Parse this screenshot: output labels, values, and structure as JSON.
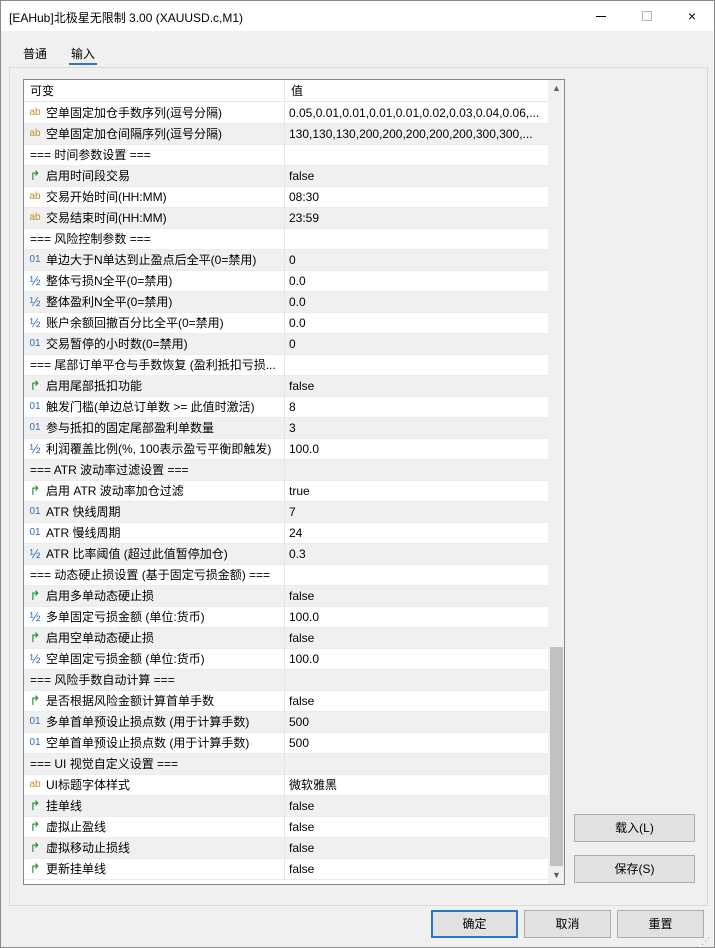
{
  "window": {
    "title": "[EAHub]北极星无限制 3.00 (XAUUSD.c,M1)",
    "controls": {
      "minimize": "minimize",
      "maximize": "maximize",
      "close": "×"
    }
  },
  "tabs": [
    {
      "label": "普通",
      "active": false
    },
    {
      "label": "输入",
      "active": true
    }
  ],
  "grid": {
    "columns": [
      "可变",
      "值"
    ],
    "rows": [
      {
        "type": "string",
        "name": "空单固定加仓手数序列(逗号分隔)",
        "value": "0.05,0.01,0.01,0.01,0.01,0.02,0.03,0.04,0.06,..."
      },
      {
        "type": "string",
        "name": "空单固定加仓间隔序列(逗号分隔)",
        "value": "130,130,130,200,200,200,200,200,300,300,..."
      },
      {
        "type": "section",
        "name": "=== 时间参数设置 ===",
        "value": ""
      },
      {
        "type": "bool",
        "name": "启用时间段交易",
        "value": "false"
      },
      {
        "type": "string",
        "name": "交易开始时间(HH:MM)",
        "value": "08:30"
      },
      {
        "type": "string",
        "name": "交易结束时间(HH:MM)",
        "value": "23:59"
      },
      {
        "type": "section",
        "name": "=== 风险控制参数 ===",
        "value": ""
      },
      {
        "type": "int",
        "name": "单边大于N单达到止盈点后全平(0=禁用)",
        "value": "0"
      },
      {
        "type": "double",
        "name": "整体亏损N全平(0=禁用)",
        "value": "0.0"
      },
      {
        "type": "double",
        "name": "整体盈利N全平(0=禁用)",
        "value": "0.0"
      },
      {
        "type": "double",
        "name": "账户余额回撤百分比全平(0=禁用)",
        "value": "0.0"
      },
      {
        "type": "int",
        "name": "交易暂停的小时数(0=禁用)",
        "value": "0"
      },
      {
        "type": "section",
        "name": "=== 尾部订单平仓与手数恢复 (盈利抵扣亏损...",
        "value": ""
      },
      {
        "type": "bool",
        "name": "启用尾部抵扣功能",
        "value": "false"
      },
      {
        "type": "int",
        "name": "触发门槛(单边总订单数 >= 此值时激活)",
        "value": "8"
      },
      {
        "type": "int",
        "name": "参与抵扣的固定尾部盈利单数量",
        "value": "3"
      },
      {
        "type": "double",
        "name": "利润覆盖比例(%, 100表示盈亏平衡即触发)",
        "value": "100.0"
      },
      {
        "type": "section",
        "name": "=== ATR 波动率过滤设置 ===",
        "value": ""
      },
      {
        "type": "bool",
        "name": "启用 ATR 波动率加仓过滤",
        "value": "true"
      },
      {
        "type": "int",
        "name": "ATR 快线周期",
        "value": "7"
      },
      {
        "type": "int",
        "name": "ATR 慢线周期",
        "value": "24"
      },
      {
        "type": "double",
        "name": "ATR 比率阈值 (超过此值暂停加仓)",
        "value": "0.3"
      },
      {
        "type": "section",
        "name": "=== 动态硬止损设置 (基于固定亏损金额) ===",
        "value": ""
      },
      {
        "type": "bool",
        "name": "启用多单动态硬止损",
        "value": "false"
      },
      {
        "type": "double",
        "name": "多单固定亏损金额 (单位:货币)",
        "value": "100.0"
      },
      {
        "type": "bool",
        "name": "启用空单动态硬止损",
        "value": "false"
      },
      {
        "type": "double",
        "name": "空单固定亏损金额 (单位:货币)",
        "value": "100.0"
      },
      {
        "type": "section",
        "name": "=== 风险手数自动计算 ===",
        "value": ""
      },
      {
        "type": "bool",
        "name": "是否根据风险金额计算首单手数",
        "value": "false"
      },
      {
        "type": "int",
        "name": "多单首单预设止损点数 (用于计算手数)",
        "value": "500"
      },
      {
        "type": "int",
        "name": "空单首单预设止损点数 (用于计算手数)",
        "value": "500"
      },
      {
        "type": "section",
        "name": "=== UI 视觉自定义设置 ===",
        "value": ""
      },
      {
        "type": "string",
        "name": "UI标题字体样式",
        "value": "微软雅黑"
      },
      {
        "type": "bool",
        "name": "挂单线",
        "value": "false"
      },
      {
        "type": "bool",
        "name": "虚拟止盈线",
        "value": "false"
      },
      {
        "type": "bool",
        "name": "虚拟移动止损线",
        "value": "false"
      },
      {
        "type": "bool",
        "name": "更新挂单线",
        "value": "false"
      }
    ]
  },
  "icons": {
    "string": {
      "glyph": "ab",
      "name": "string-type-icon"
    },
    "int": {
      "glyph": "01",
      "name": "integer-type-icon"
    },
    "double": {
      "glyph": "½",
      "name": "double-type-icon"
    },
    "bool": {
      "glyph": "↱",
      "name": "boolean-type-icon"
    }
  },
  "side_buttons": {
    "load": "载入(L)",
    "save": "保存(S)"
  },
  "footer_buttons": {
    "ok": "确定",
    "cancel": "取消",
    "reset": "重置"
  },
  "colors": {
    "accent": "#2a74c9",
    "string_icon": "#c58a1a",
    "number_icon": "#2a6fbf",
    "bool_icon": "#1e8c2f"
  }
}
